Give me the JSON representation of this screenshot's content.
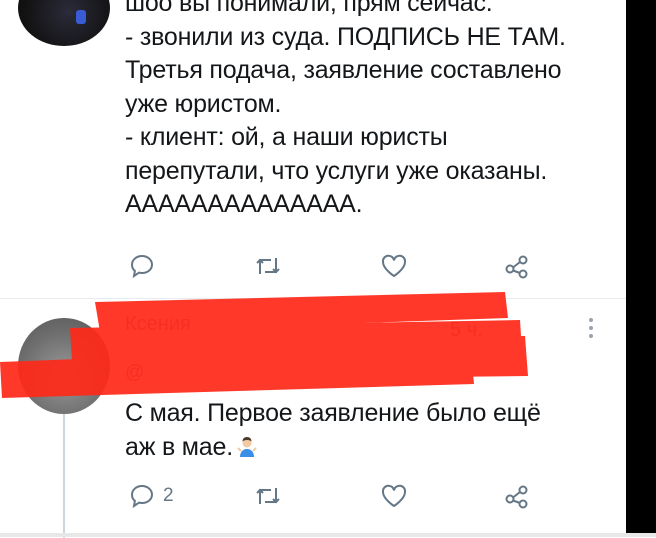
{
  "tweet1": {
    "lines": [
      "шоо вы понимали, прям сейчас.",
      "- звонили из суда. ПОДПИСЬ НЕ ТАМ.",
      "Третья подача, заявление составлено",
      "уже юристом.",
      "- клиент: ой, а наши юристы",
      "перепутали, что услуги уже оказаны.",
      "АААААААААААААА."
    ],
    "actions": {
      "reply_count": "",
      "retweet_count": "",
      "like_count": ""
    }
  },
  "tweet2": {
    "author_name": "Ксения",
    "time": "5 ч.",
    "handle": "@",
    "lines": [
      "С мая. Первое заявление было ещё",
      "аж в мае."
    ],
    "emoji": "person-shrugging",
    "actions": {
      "reply_count": "2",
      "retweet_count": "",
      "like_count": ""
    }
  },
  "colors": {
    "text": "#14171a",
    "muted": "#657786",
    "redaction": "#ff2a1a"
  }
}
